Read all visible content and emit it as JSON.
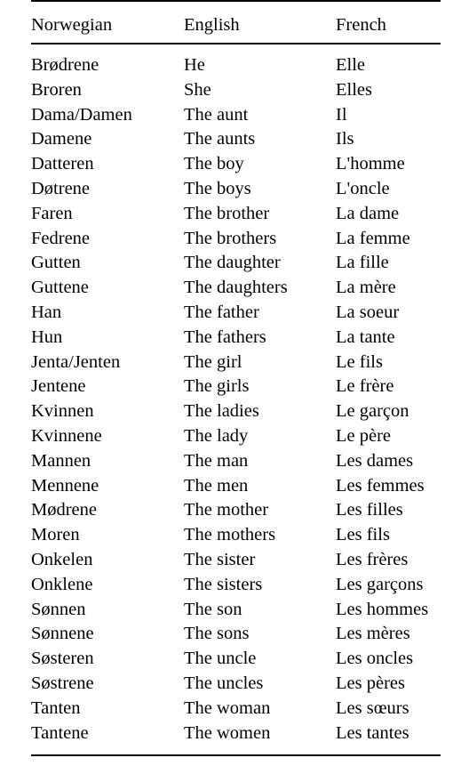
{
  "table": {
    "columns": [
      "Norwegian",
      "English",
      "French"
    ],
    "rows": [
      [
        "Brødrene",
        "He",
        "Elle"
      ],
      [
        "Broren",
        "She",
        "Elles"
      ],
      [
        "Dama/Damen",
        "The aunt",
        "Il"
      ],
      [
        "Damene",
        "The aunts",
        "Ils"
      ],
      [
        "Datteren",
        "The boy",
        "L'homme"
      ],
      [
        "Døtrene",
        "The boys",
        "L'oncle"
      ],
      [
        "Faren",
        "The brother",
        "La dame"
      ],
      [
        "Fedrene",
        "The brothers",
        "La femme"
      ],
      [
        "Gutten",
        "The daughter",
        "La fille"
      ],
      [
        "Guttene",
        "The daughters",
        "La mère"
      ],
      [
        "Han",
        "The father",
        "La soeur"
      ],
      [
        "Hun",
        "The fathers",
        "La tante"
      ],
      [
        "Jenta/Jenten",
        "The girl",
        "Le fils"
      ],
      [
        "Jentene",
        "The girls",
        "Le frère"
      ],
      [
        "Kvinnen",
        "The ladies",
        "Le garçon"
      ],
      [
        "Kvinnene",
        "The lady",
        "Le père"
      ],
      [
        "Mannen",
        "The man",
        "Les dames"
      ],
      [
        "Mennene",
        "The men",
        "Les femmes"
      ],
      [
        "Mødrene",
        "The mother",
        "Les filles"
      ],
      [
        "Moren",
        "The mothers",
        "Les fils"
      ],
      [
        "Onkelen",
        "The sister",
        "Les frères"
      ],
      [
        "Onklene",
        "The sisters",
        "Les garçons"
      ],
      [
        "Sønnen",
        "The son",
        "Les hommes"
      ],
      [
        "Sønnene",
        "The sons",
        "Les mères"
      ],
      [
        "Søsteren",
        "The uncle",
        "Les oncles"
      ],
      [
        "Søstrene",
        "The uncles",
        "Les pères"
      ],
      [
        "Tanten",
        "The woman",
        "Les sœurs"
      ],
      [
        "Tantene",
        "The women",
        "Les tantes"
      ]
    ]
  },
  "colors": {
    "text": "#000000",
    "rule": "#000000",
    "background": "#ffffff"
  }
}
